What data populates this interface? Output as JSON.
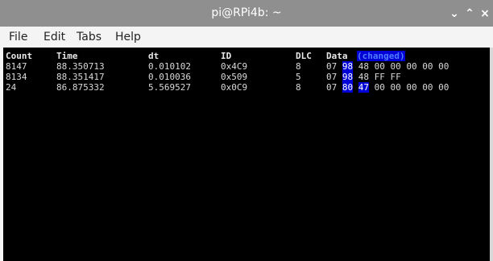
{
  "window": {
    "title": "pi@RPi4b: ~"
  },
  "menubar": {
    "items": [
      "File",
      "Edit",
      "Tabs",
      "Help"
    ]
  },
  "terminal": {
    "headers": {
      "count": "Count",
      "time": "Time",
      "dt": "dt",
      "id": "ID",
      "dlc": "DLC",
      "data": "Data",
      "changed": "(changed)"
    },
    "rows": [
      {
        "count": "8147",
        "time": "88.350713",
        "dt": "0.010102",
        "id": "0x4C9",
        "dlc": "8",
        "bytes": [
          "07",
          "98",
          "48",
          "00",
          "00",
          "00",
          "00",
          "00"
        ],
        "changed": [
          1
        ]
      },
      {
        "count": "8134",
        "time": "88.351417",
        "dt": "0.010036",
        "id": "0x509",
        "dlc": "5",
        "bytes": [
          "07",
          "98",
          "48",
          "FF",
          "FF"
        ],
        "changed": [
          1
        ]
      },
      {
        "count": "24",
        "time": "86.875332",
        "dt": "5.569527",
        "id": "0x0C9",
        "dlc": "8",
        "bytes": [
          "07",
          "80",
          "47",
          "00",
          "00",
          "00",
          "00",
          "00"
        ],
        "changed": [
          1,
          2
        ]
      }
    ]
  },
  "colors": {
    "highlight": "#0000d6",
    "terminal_bg": "#000000",
    "titlebar": "#8f8f8f"
  }
}
